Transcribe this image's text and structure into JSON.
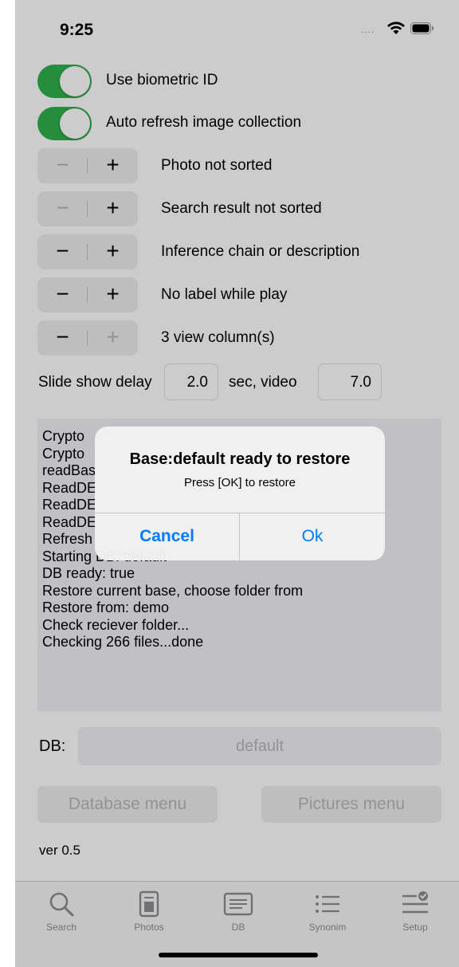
{
  "status_bar": {
    "time": "9:25",
    "signal": "....",
    "wifi_icon": "wifi-icon",
    "battery_icon": "battery-icon"
  },
  "toggles": [
    {
      "label": "Use biometric ID",
      "on": true
    },
    {
      "label": "Auto refresh image collection",
      "on": true
    }
  ],
  "steppers": [
    {
      "label": "Photo not sorted",
      "minus_enabled": false,
      "plus_enabled": true
    },
    {
      "label": "Search result not sorted",
      "minus_enabled": false,
      "plus_enabled": true
    },
    {
      "label": "Inference chain or description",
      "minus_enabled": true,
      "plus_enabled": true
    },
    {
      "label": "No label while play",
      "minus_enabled": true,
      "plus_enabled": true
    },
    {
      "label": "3 view column(s)",
      "minus_enabled": true,
      "plus_enabled": false
    }
  ],
  "slideshow": {
    "label": "Slide show delay",
    "delay_value": "2.0",
    "mid_label": "sec,  video",
    "video_value": "7.0"
  },
  "log": {
    "lines": [
      "Crypto",
      "Crypto",
      "readBas",
      "ReadDE",
      "ReadDE",
      "ReadDE",
      "Refresh",
      "Starting DB: default",
      "DB ready: true",
      "Restore current base, choose folder from",
      "Restore from: demo",
      "Check reciever folder...",
      "Checking 266 files...done"
    ]
  },
  "db": {
    "label": "DB:",
    "value": "default"
  },
  "buttons": {
    "database_menu": "Database menu",
    "pictures_menu": "Pictures menu"
  },
  "version": "ver 0.5",
  "tabs": [
    {
      "label": "Search",
      "icon": "search-icon"
    },
    {
      "label": "Photos",
      "icon": "photos-icon"
    },
    {
      "label": "DB",
      "icon": "db-icon"
    },
    {
      "label": "Synonim",
      "icon": "list-icon"
    },
    {
      "label": "Setup",
      "icon": "setup-icon"
    }
  ],
  "alert": {
    "title": "Base:default ready to restore",
    "message": "Press [OK] to restore",
    "cancel": "Cancel",
    "ok": "Ok"
  },
  "colors": {
    "switch_on": "#2fb24c",
    "accent": "#007aff",
    "tab_inactive": "#8e8e93"
  }
}
